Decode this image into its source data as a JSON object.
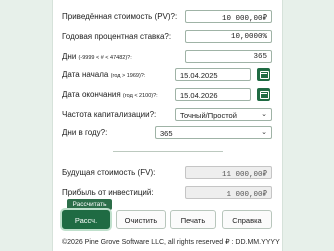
{
  "colors": {
    "accent": "#1f6b43",
    "background": "#e7f0ea"
  },
  "form": {
    "pv_label": "Приведённая стоимость (PV)?:",
    "pv_value": "10 000,00₽",
    "rate_label": "Годовая процентная ставка?:",
    "rate_value": "10,0000%",
    "days_label": "Дни",
    "days_hint": "(-9999 < # < 47482)?:",
    "days_value": "365",
    "start_label": "Дата начала",
    "start_hint": "(год > 1969)?:",
    "start_value": "15.04.2025",
    "end_label": "Дата окончания",
    "end_hint": "(год < 2100)?:",
    "end_value": "15.04.2026",
    "comp_label": "Частота капитализации?:",
    "comp_value": "Точный/Простой",
    "dpy_label": "Дни в году?:",
    "dpy_value": "365",
    "fv_label": "Будущая стоимость (FV):",
    "fv_value": "11 000,00₽",
    "profit_label": "Прибыль от инвестиций:",
    "profit_value": "1 000,00₽"
  },
  "icons": {
    "calendar": "calendar-icon",
    "chevron": "chevron-down-icon",
    "chevron_glyph": "⌄"
  },
  "tooltip": "Рассчитать",
  "buttons": {
    "calc": "Рассч.",
    "clear": "Очистить",
    "print": "Печать",
    "help": "Справка"
  },
  "footer": "©2026 Pine Grove Software LLC, all rights reserved  ₽ : DD.MM.YYYY"
}
